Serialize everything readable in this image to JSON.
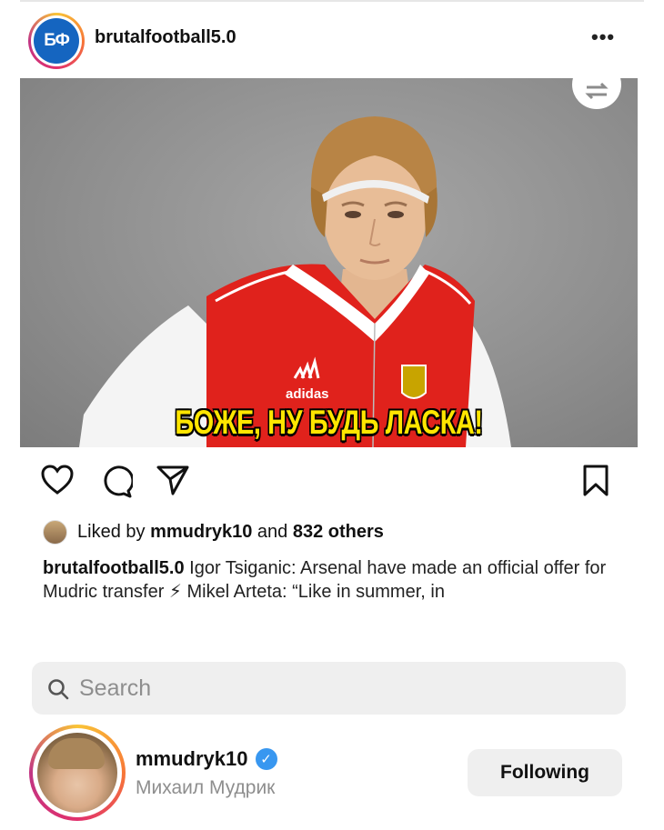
{
  "post": {
    "username": "brutalfootball5.0",
    "avatar_text": "БФ",
    "more_label": "•••",
    "image_caption": "БОЖЕ, НУ БУДЬ ЛАСКА!",
    "likes": {
      "prefix": "Liked by ",
      "user": "mmudryk10",
      "middle": " and ",
      "others": "832 others"
    },
    "caption": {
      "user": "brutalfootball5.0",
      "text": " Igor Tsiganic: Arsenal have made an official offer for Mudric transfer ⚡ Mikel Arteta: “Like in summer, in"
    }
  },
  "search": {
    "placeholder": "Search"
  },
  "profile": {
    "username": "mmudryk10",
    "verified": "✓",
    "full_name": "Михаил Мудрик",
    "follow_button": "Following"
  },
  "colors": {
    "accent_blue": "#3897f0",
    "overlay_yellow": "#ffe600",
    "jersey_red": "#e0221c"
  }
}
